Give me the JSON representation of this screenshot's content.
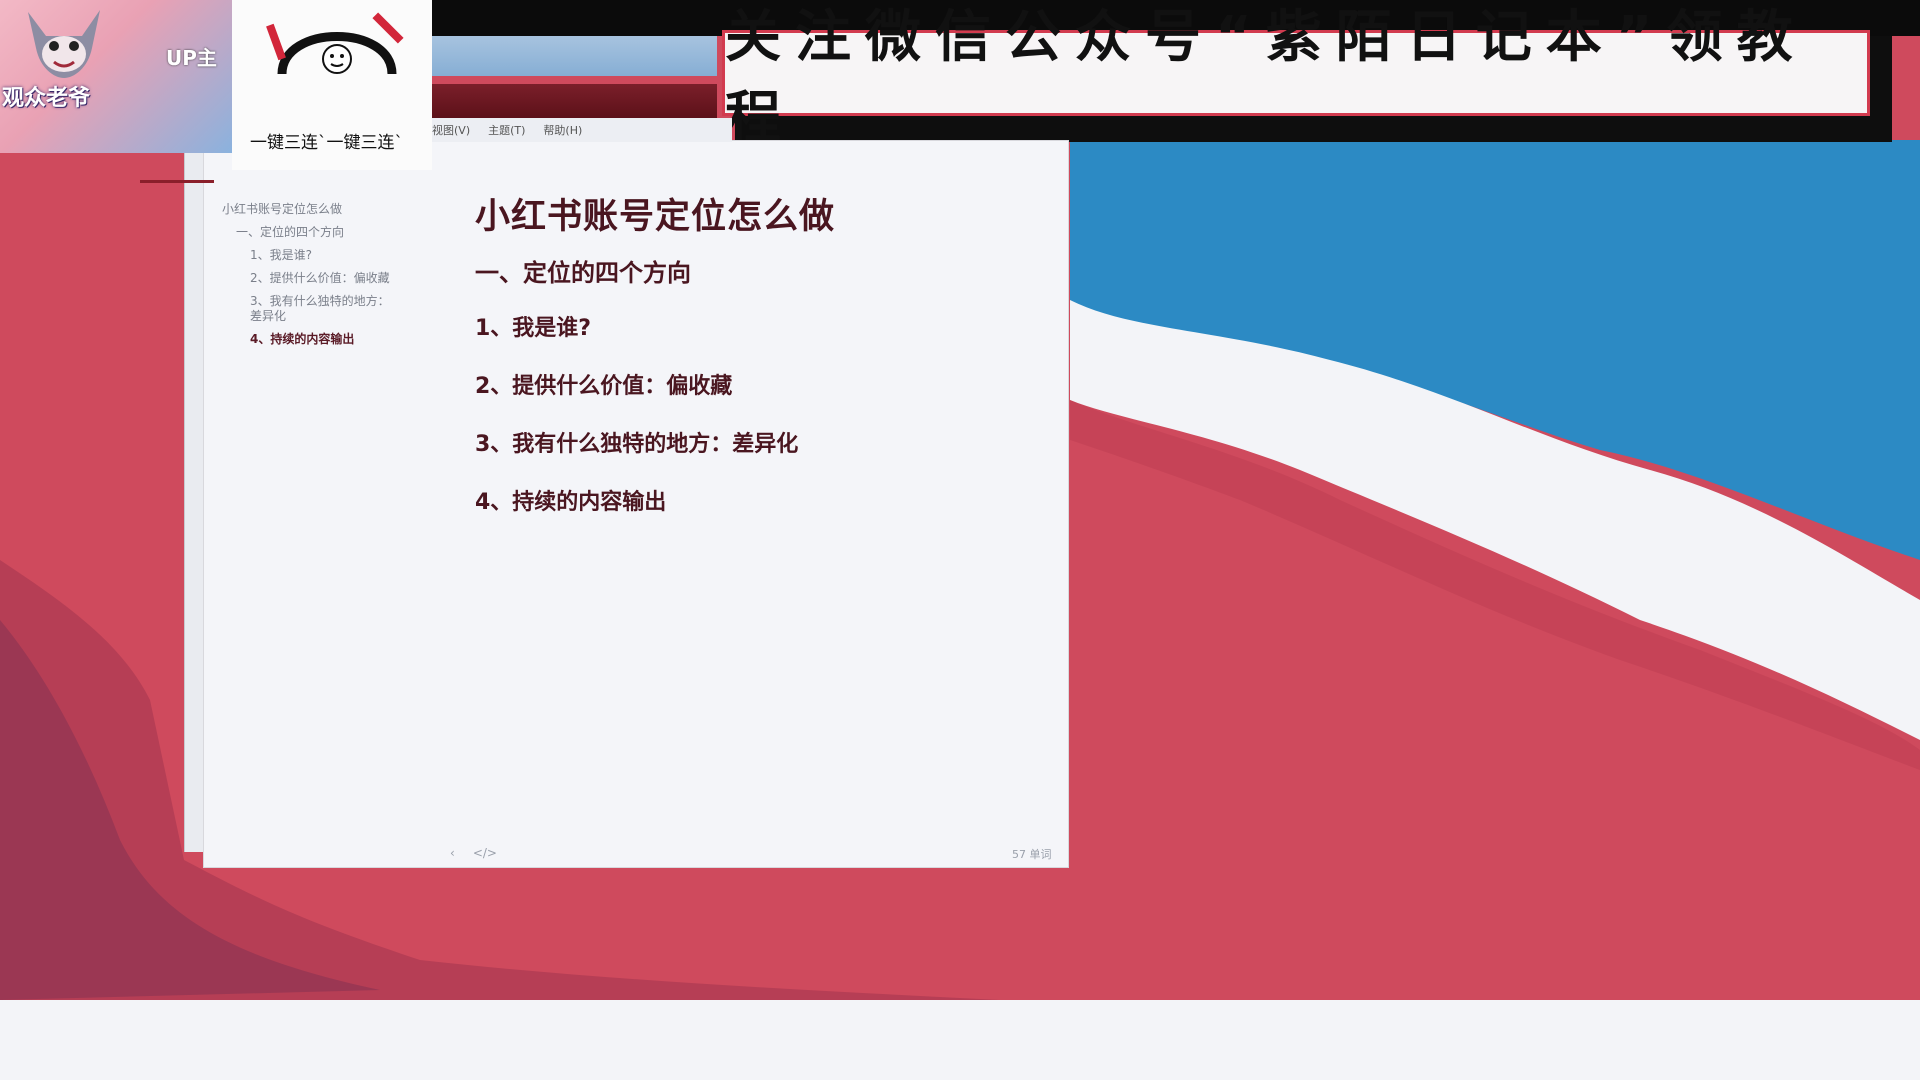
{
  "banner": {
    "text": "关注微信公众号“紫陌日记本”领教程"
  },
  "cam_overlay": {
    "up_label": "UP主",
    "name_label": "观众老爷"
  },
  "sticker": {
    "caption": "一键三连`一键三连`"
  },
  "menubar": {
    "items": [
      "视图(V)",
      "主题(T)",
      "帮助(H)"
    ]
  },
  "outline": {
    "items": [
      {
        "text": "小红书账号定位怎么做",
        "level": 0
      },
      {
        "text": "一、定位的四个方向",
        "level": 1
      },
      {
        "text": "1、我是谁?",
        "level": 2
      },
      {
        "text": "2、提供什么价值：偏收藏",
        "level": 2
      },
      {
        "text": "3、我有什么独特的地方：差异化",
        "level": 2
      },
      {
        "text": "4、持续的内容输出",
        "level": 2
      }
    ]
  },
  "document": {
    "title": "小红书账号定位怎么做",
    "heading": "一、定位的四个方向",
    "items": [
      "1、我是谁?",
      "2、提供什么价值：偏收藏",
      "3、我有什么独特的地方：差异化",
      "4、持续的内容输出"
    ]
  },
  "footer": {
    "left_back": "‹",
    "left_code": "</>",
    "right_label": "57 单词"
  },
  "colors": {
    "wallpaper_red": "#cf4a5d",
    "wallpaper_blue": "#2c8ac4",
    "banner_border": "#d23b4f",
    "doc_text": "#4a1620"
  }
}
